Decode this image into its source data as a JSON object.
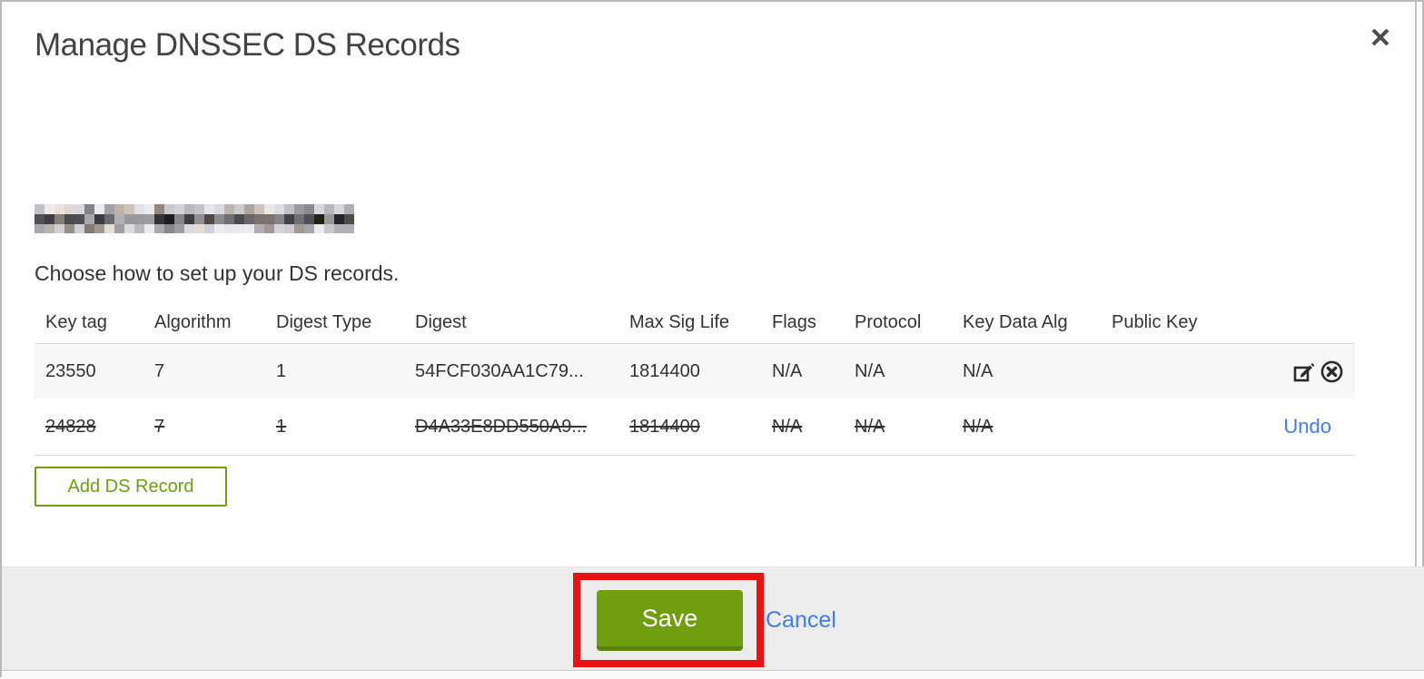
{
  "modal": {
    "title": "Manage DNSSEC DS Records",
    "instruction": "Choose how to set up your DS records.",
    "domain_redacted": true,
    "table": {
      "columns": {
        "key_tag": "Key tag",
        "algorithm": "Algorithm",
        "digest_type": "Digest Type",
        "digest": "Digest",
        "max_sig_life": "Max Sig Life",
        "flags": "Flags",
        "protocol": "Protocol",
        "key_data_alg": "Key Data Alg",
        "public_key": "Public Key"
      },
      "rows": [
        {
          "key_tag": "23550",
          "algorithm": "7",
          "digest_type": "1",
          "digest": "54FCF030AA1C79...",
          "max_sig_life": "1814400",
          "flags": "N/A",
          "protocol": "N/A",
          "key_data_alg": "N/A",
          "public_key": "",
          "state": "active",
          "actions": [
            "edit",
            "remove"
          ]
        },
        {
          "key_tag": "24828",
          "algorithm": "7",
          "digest_type": "1",
          "digest": "D4A33E8DD550A9...",
          "max_sig_life": "1814400",
          "flags": "N/A",
          "protocol": "N/A",
          "key_data_alg": "N/A",
          "public_key": "",
          "state": "marked-for-deletion",
          "undo_label": "Undo"
        }
      ]
    },
    "add_button_label": "Add DS Record",
    "footer": {
      "save_label": "Save",
      "cancel_label": "Cancel"
    }
  },
  "annotation": {
    "type": "red-highlight-box",
    "target": "save-button",
    "color": "#ee1111"
  },
  "colors": {
    "accent_green": "#6f9e0f",
    "accent_green_dark": "#5d8409",
    "outline_green": "#6ba10e",
    "link_blue": "#3d7df5",
    "row_alt_bg": "#f7f7f7",
    "footer_bg": "#ededed",
    "text": "#333333",
    "title_text": "#434343"
  }
}
